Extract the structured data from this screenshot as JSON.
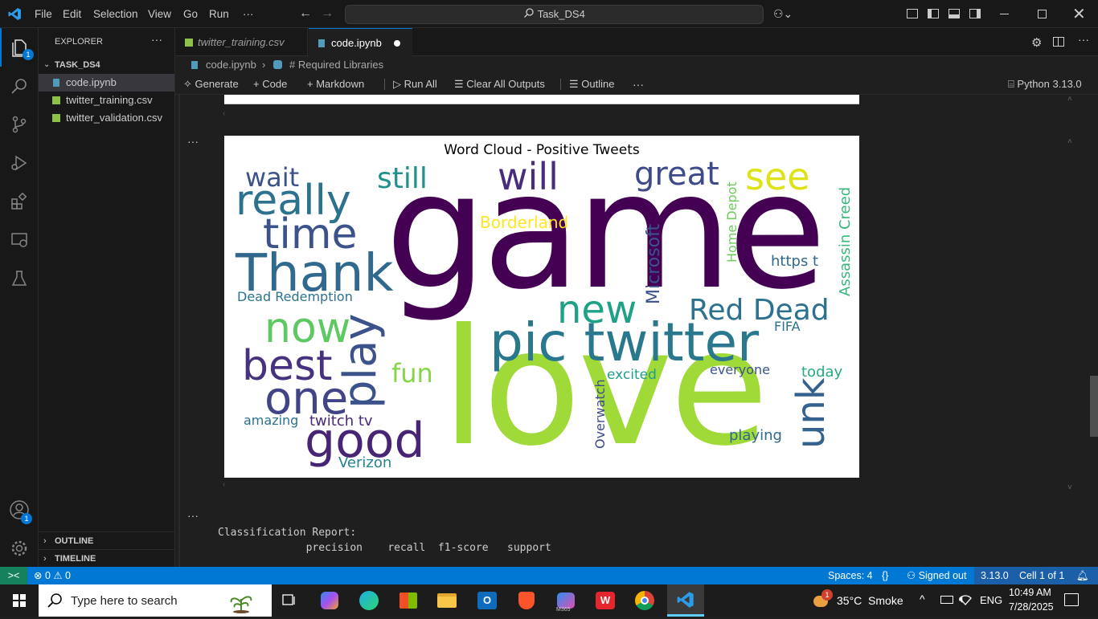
{
  "menu": {
    "file": "File",
    "edit": "Edit",
    "selection": "Selection",
    "view": "View",
    "go": "Go",
    "run": "Run",
    "more": "···"
  },
  "search": {
    "text": "Task_DS4"
  },
  "activity": {
    "explorer_badge": "1",
    "account_badge": "1"
  },
  "sidebar": {
    "header": "EXPLORER",
    "more": "···",
    "folder": "TASK_DS4",
    "files": [
      {
        "label": "code.ipynb"
      },
      {
        "label": "twitter_training.csv"
      },
      {
        "label": "twitter_validation.csv"
      }
    ],
    "outline": "OUTLINE",
    "timeline": "TIMELINE"
  },
  "tabs": [
    {
      "label": "twitter_training.csv"
    },
    {
      "label": "code.ipynb"
    }
  ],
  "breadcrumb": {
    "file": "code.ipynb",
    "section": "# Required Libraries"
  },
  "toolbar": {
    "generate": "Generate",
    "code": "Code",
    "markdown": "Markdown",
    "run_all": "Run All",
    "clear": "Clear All Outputs",
    "outline": "Outline",
    "more": "···",
    "kernel": "Python 3.13.0"
  },
  "cells": {
    "ellipsis": "···",
    "wordcloud_title": "Word Cloud - Positive Tweets",
    "report_title": "Classification Report:",
    "report_header": "              precision    recall  f1-score   support"
  },
  "wordcloud_words": [
    {
      "t": "game",
      "c": "#440154"
    },
    {
      "t": "love",
      "c": "#a0da39"
    },
    {
      "t": "pic twitter",
      "c": "#2a788e"
    },
    {
      "t": "Thank",
      "c": "#31688e"
    },
    {
      "t": "really",
      "c": "#2c728e"
    },
    {
      "t": "time",
      "c": "#3b528b"
    },
    {
      "t": "best",
      "c": "#46327e"
    },
    {
      "t": "one",
      "c": "#414487"
    },
    {
      "t": "good",
      "c": "#482475"
    },
    {
      "t": "now",
      "c": "#5ec962"
    },
    {
      "t": "play",
      "c": "#3b528b"
    },
    {
      "t": "new",
      "c": "#1fa187"
    },
    {
      "t": "will",
      "c": "#472d7b"
    },
    {
      "t": "great",
      "c": "#3e4a89"
    },
    {
      "t": "see",
      "c": "#dde318"
    },
    {
      "t": "still",
      "c": "#21918c"
    },
    {
      "t": "wait",
      "c": "#3b528b"
    },
    {
      "t": "Red Dead",
      "c": "#2c728e"
    },
    {
      "t": "unk",
      "c": "#34618d"
    },
    {
      "t": "fun",
      "c": "#86d549"
    },
    {
      "t": "Microsoft",
      "c": "#3b528b"
    },
    {
      "t": "Borderland",
      "c": "#fde725"
    },
    {
      "t": "Assassin Creed",
      "c": "#35b779"
    },
    {
      "t": "Home Depot",
      "c": "#6ccd5a"
    },
    {
      "t": "https t",
      "c": "#31688e"
    },
    {
      "t": "Dead Redemption",
      "c": "#2c728e"
    },
    {
      "t": "Verizon",
      "c": "#25838e"
    },
    {
      "t": "twitch tv",
      "c": "#482878"
    },
    {
      "t": "amazing",
      "c": "#2c728e"
    },
    {
      "t": "Overwatch",
      "c": "#3e4a89"
    },
    {
      "t": "playing",
      "c": "#31688e"
    },
    {
      "t": "FIFA",
      "c": "#2c728e"
    },
    {
      "t": "excited",
      "c": "#1f9e89"
    },
    {
      "t": "everyone",
      "c": "#3b528b"
    },
    {
      "t": "today",
      "c": "#25ab82"
    }
  ],
  "statusbar": {
    "remote": "><",
    "problems": "⊗ 0 ⚠ 0",
    "spaces": "Spaces: 4",
    "braces": "{}",
    "signed": "Signed out",
    "version": "3.13.0",
    "cell": "Cell 1 of 1"
  },
  "taskbar": {
    "search": "Type here to search",
    "weather": "35°C  Smoke",
    "lang": "ENG",
    "time": "10:49 AM",
    "date": "7/28/2025",
    "m365": "M365",
    "weather_badge": "1"
  }
}
